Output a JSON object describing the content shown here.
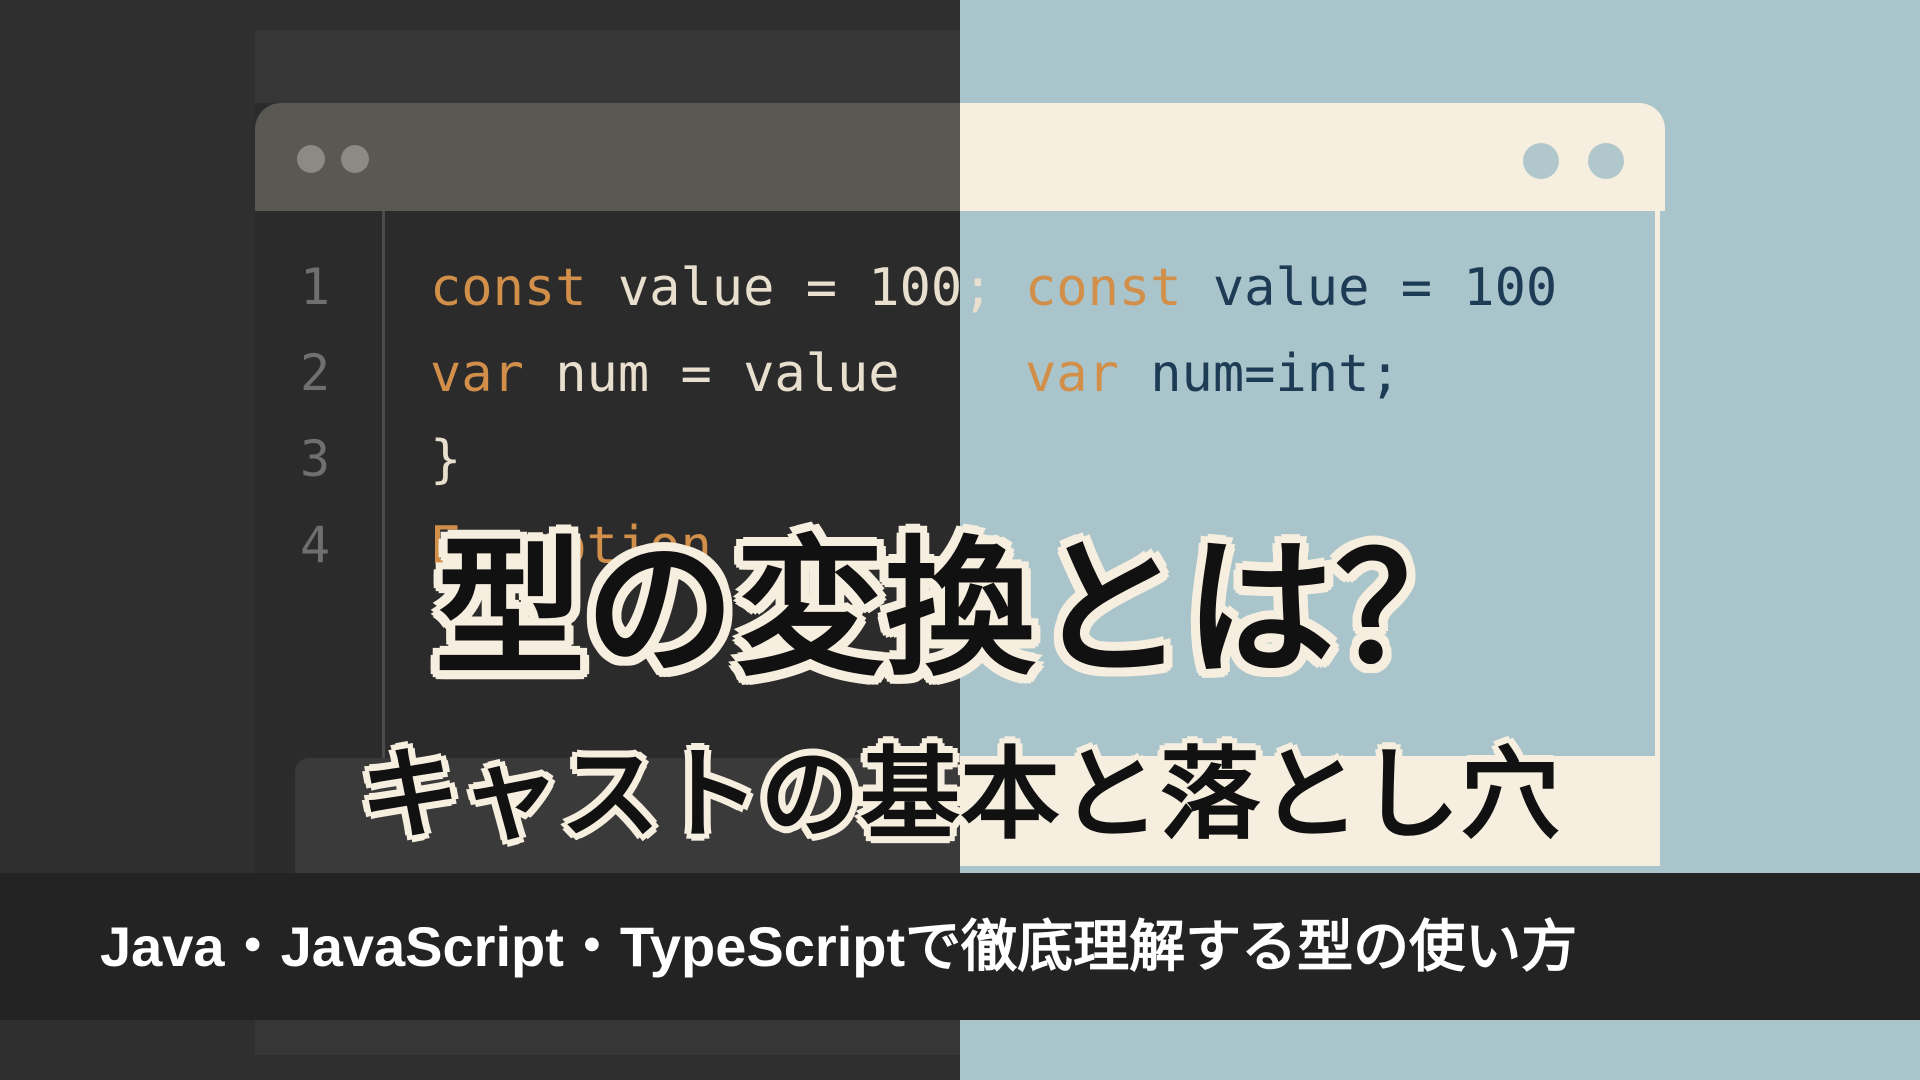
{
  "editor_dark": {
    "line_numbers": [
      "1",
      "2",
      "3",
      "4"
    ],
    "lines": [
      {
        "kw": "const",
        "rest": " value = 100;"
      },
      {
        "kw": "var",
        "rest": " num = value"
      },
      {
        "kw": "",
        "rest": "}"
      },
      {
        "kw": "Exception",
        "rest": ""
      }
    ]
  },
  "editor_light": {
    "lines": [
      {
        "kw": "const",
        "rest": " value = 100"
      },
      {
        "kw": "var",
        "rest": " num=int;"
      }
    ]
  },
  "title": "型の変換とは？",
  "subtitle": "キャストの基本と落とし穴",
  "banner": "Java・JavaScript・TypeScriptで徹底理解する型の使い方",
  "colors": {
    "keyword": "#d18f4a",
    "dark_bg": "#2f2f30",
    "light_bg": "#a9c4cb",
    "cream": "#f6eedf"
  }
}
